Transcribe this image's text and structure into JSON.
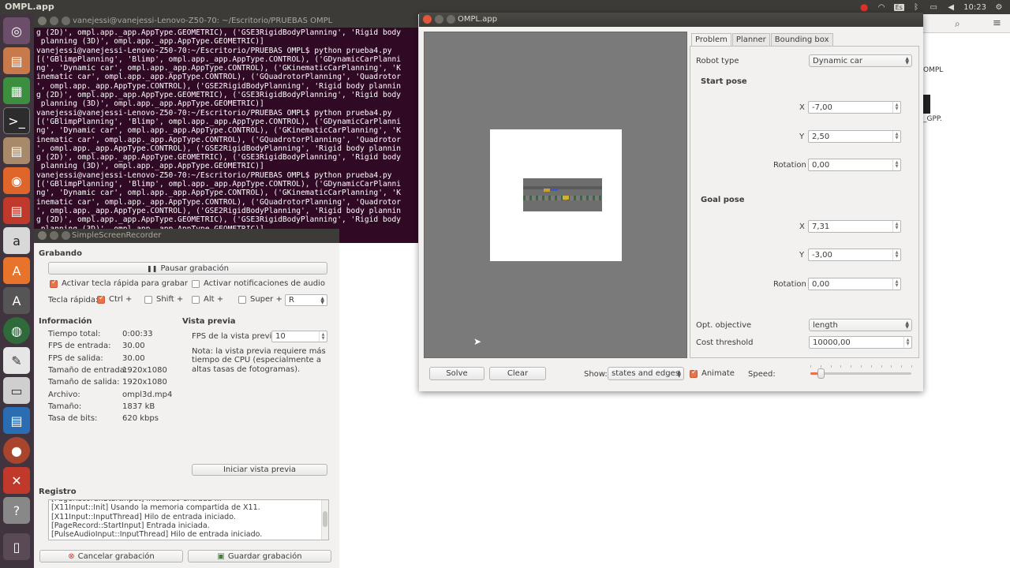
{
  "topbar": {
    "app_title": "OMPL.app",
    "keyboard_layout": "Es",
    "clock": "10:23"
  },
  "terminal": {
    "title": "vanejessi@vanejessi-Lenovo-Z50-70: ~/Escritorio/PRUEBAS OMPL",
    "lines": [
      "g (2D)', ompl.app._app.AppType.GEOMETRIC), ('GSE3RigidBodyPlanning', 'Rigid body",
      " planning (3D)', ompl.app._app.AppType.GEOMETRIC)]",
      "vanejessi@vanejessi-Lenovo-Z50-70:~/Escritorio/PRUEBAS OMPL$ python prueba4.py",
      "[('GBlimpPlanning', 'Blimp', ompl.app._app.AppType.CONTROL), ('GDynamicCarPlanni",
      "ng', 'Dynamic car', ompl.app._app.AppType.CONTROL), ('GKinematicCarPlanning', 'K",
      "inematic car', ompl.app._app.AppType.CONTROL), ('GQuadrotorPlanning', 'Quadrotor",
      "', ompl.app._app.AppType.CONTROL), ('GSE2RigidBodyPlanning', 'Rigid body plannin",
      "g (2D)', ompl.app._app.AppType.GEOMETRIC), ('GSE3RigidBodyPlanning', 'Rigid body",
      " planning (3D)', ompl.app._app.AppType.GEOMETRIC)]",
      "vanejessi@vanejessi-Lenovo-Z50-70:~/Escritorio/PRUEBAS OMPL$ python prueba4.py",
      "[('GBlimpPlanning', 'Blimp', ompl.app._app.AppType.CONTROL), ('GDynamicCarPlanni",
      "ng', 'Dynamic car', ompl.app._app.AppType.CONTROL), ('GKinematicCarPlanning', 'K",
      "inematic car', ompl.app._app.AppType.CONTROL), ('GQuadrotorPlanning', 'Quadrotor",
      "', ompl.app._app.AppType.CONTROL), ('GSE2RigidBodyPlanning', 'Rigid body plannin",
      "g (2D)', ompl.app._app.AppType.GEOMETRIC), ('GSE3RigidBodyPlanning', 'Rigid body",
      " planning (3D)', ompl.app._app.AppType.GEOMETRIC)]",
      "vanejessi@vanejessi-Lenovo-Z50-70:~/Escritorio/PRUEBAS OMPL$ python prueba4.py",
      "[('GBlimpPlanning', 'Blimp', ompl.app._app.AppType.CONTROL), ('GDynamicCarPlanni",
      "ng', 'Dynamic car', ompl.app._app.AppType.CONTROL), ('GKinematicCarPlanning', 'K",
      "inematic car', ompl.app._app.AppType.CONTROL), ('GQuadrotorPlanning', 'Quadrotor",
      "', ompl.app._app.AppType.CONTROL), ('GSE2RigidBodyPlanning', 'Rigid body plannin",
      "g (2D)', ompl.app._app.AppType.GEOMETRIC), ('GSE3RigidBodyPlanning', 'Rigid body",
      " planning (3D)', ompl.app._app.AppType.GEOMETRIC)]"
    ]
  },
  "desktop": {
    "label_1": "OMPL",
    "label_2": "_GPP."
  },
  "ssr": {
    "title": "SimpleScreenRecorder",
    "recording_title": "Grabando",
    "pause_label": "Pausar grabación",
    "hotkey_enable": "Activar tecla rápida para grabar",
    "audio_notify": "Activar notificaciones de audio",
    "hotkey_label": "Tecla rápida:",
    "ctrl": "Ctrl +",
    "shift": "Shift +",
    "alt": "Alt +",
    "super": "Super +",
    "hotkey_key": "R",
    "info_title": "Información",
    "info": [
      {
        "label": "Tiempo total:",
        "value": "0:00:33"
      },
      {
        "label": "FPS de entrada:",
        "value": "30.00"
      },
      {
        "label": "FPS de salida:",
        "value": "30.00"
      },
      {
        "label": "Tamaño de entrada:",
        "value": "1920x1080"
      },
      {
        "label": "Tamaño de salida:",
        "value": "1920x1080"
      },
      {
        "label": "Archivo:",
        "value": "ompl3d.mp4"
      },
      {
        "label": "Tamaño:",
        "value": "1837 kB"
      },
      {
        "label": "Tasa de bits:",
        "value": "620 kbps"
      }
    ],
    "preview_title": "Vista previa",
    "preview_fps_label": "FPS de la vista previa:",
    "preview_fps_value": "10",
    "preview_note": "Nota: la vista previa requiere más tiempo de CPU (especialmente a altas tasas de fotogramas).",
    "preview_button": "Iniciar vista previa",
    "log_title": "Registro",
    "log": [
      "[PageRecord::StartInput] Iniciando entrada ...",
      "[X11Input::Init] Usando la memoria compartida de X11.",
      "[X11Input::InputThread] Hilo de entrada iniciado.",
      "[PageRecord::StartInput] Entrada iniciada.",
      "[PulseAudioInput::InputThread] Hilo de entrada iniciado."
    ],
    "cancel_label": "Cancelar grabación",
    "save_label": "Guardar grabación"
  },
  "ompl": {
    "title": "OMPL.app",
    "tabs": [
      "Problem",
      "Planner",
      "Bounding box"
    ],
    "robot_type_label": "Robot type",
    "robot_type_value": "Dynamic car",
    "start_pose_title": "Start pose",
    "goal_pose_title": "Goal pose",
    "x_label": "X",
    "y_label": "Y",
    "rotation_label": "Rotation",
    "start": {
      "x": "-7,00",
      "y": "2,50",
      "rotation": "0,00"
    },
    "goal": {
      "x": "7,31",
      "y": "-3,00",
      "rotation": "0,00"
    },
    "opt_objective_label": "Opt. objective",
    "opt_objective_value": "length",
    "cost_threshold_label": "Cost threshold",
    "cost_threshold_value": "10000,00",
    "solve_label": "Solve",
    "clear_label": "Clear",
    "show_label": "Show:",
    "show_value": "states and edges",
    "animate_label": "Animate",
    "speed_label": "Speed:",
    "speed_fraction": 0.1
  },
  "colors": {
    "accent": "#e8724a",
    "terminal_bg": "#300a24",
    "launcher_bg": "#40343e",
    "viewport_bg": "#7a7a7a"
  }
}
